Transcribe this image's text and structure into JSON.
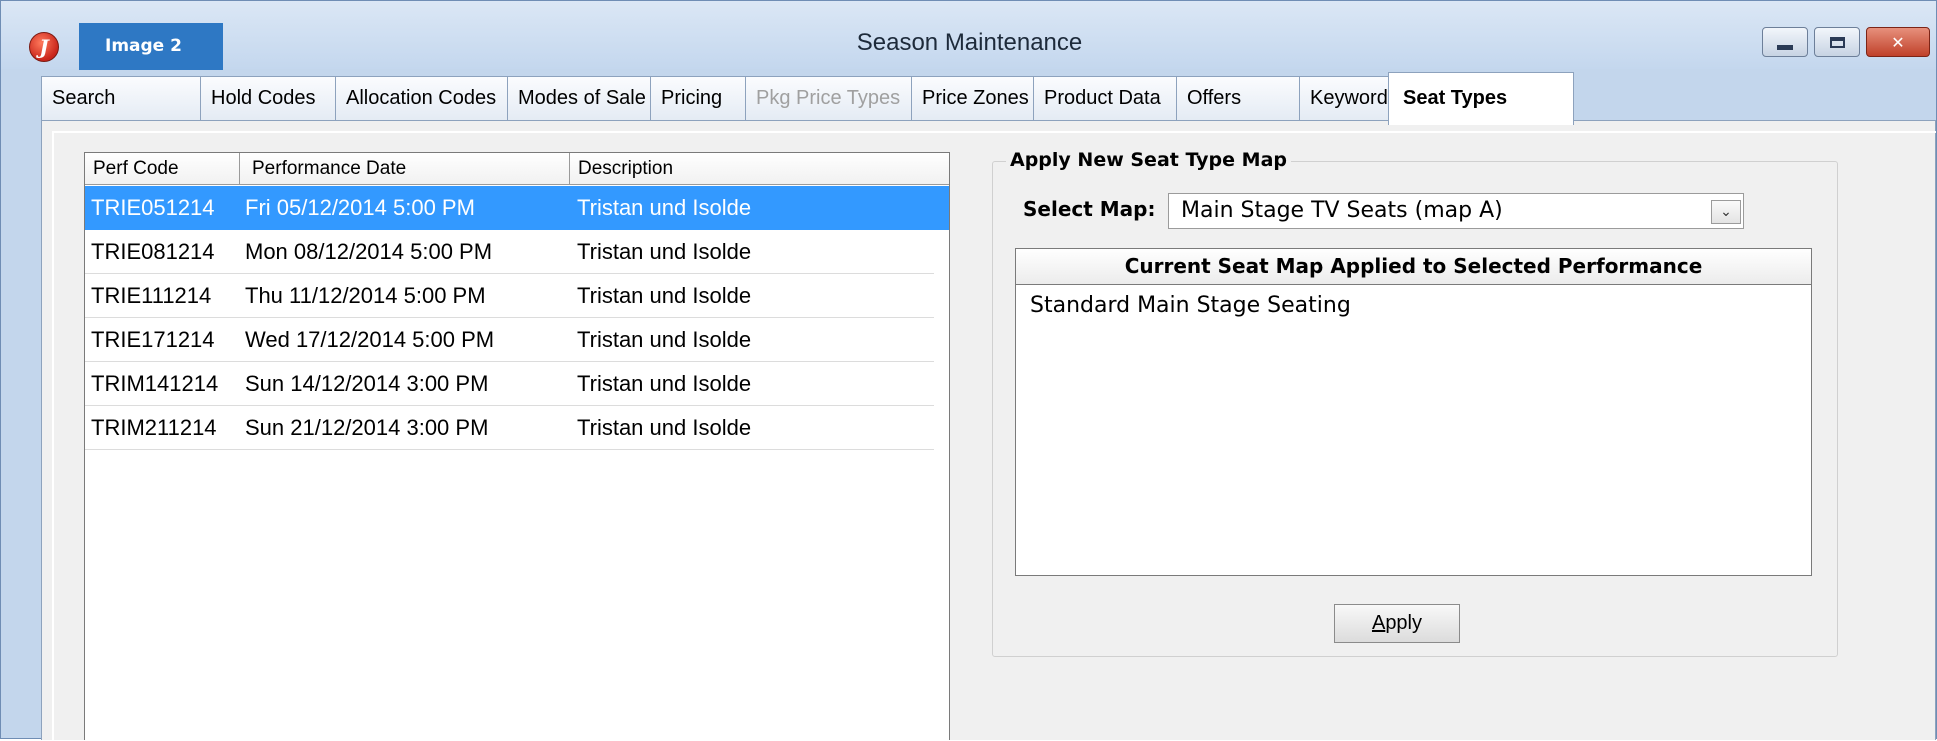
{
  "window": {
    "title": "Season Maintenance",
    "image_tag": "Image 2",
    "app_icon_glyph": "J",
    "accent_color": "#3399ff"
  },
  "tabs": [
    {
      "label": "Search",
      "state": "normal"
    },
    {
      "label": "Hold Codes",
      "state": "normal"
    },
    {
      "label": "Allocation Codes",
      "state": "normal"
    },
    {
      "label": "Modes of Sale",
      "state": "normal"
    },
    {
      "label": "Pricing",
      "state": "normal"
    },
    {
      "label": "Pkg Price Types",
      "state": "disabled"
    },
    {
      "label": "Price Zones",
      "state": "normal"
    },
    {
      "label": "Product Data",
      "state": "normal"
    },
    {
      "label": "Offers",
      "state": "normal"
    },
    {
      "label": "Keywords",
      "state": "normal"
    },
    {
      "label": "Seat Types",
      "state": "active"
    }
  ],
  "performance_list": {
    "columns": [
      "Perf Code",
      "Performance Date",
      "Description"
    ],
    "rows": [
      {
        "code": "TRIE051214",
        "date": "Fri 05/12/2014 5:00 PM",
        "description": "Tristan und Isolde",
        "selected": true
      },
      {
        "code": "TRIE081214",
        "date": "Mon 08/12/2014 5:00 PM",
        "description": "Tristan und Isolde",
        "selected": false
      },
      {
        "code": "TRIE111214",
        "date": "Thu 11/12/2014 5:00 PM",
        "description": "Tristan und Isolde",
        "selected": false
      },
      {
        "code": "TRIE171214",
        "date": "Wed 17/12/2014 5:00 PM",
        "description": "Tristan und Isolde",
        "selected": false
      },
      {
        "code": "TRIM141214",
        "date": "Sun 14/12/2014 3:00 PM",
        "description": "Tristan und Isolde",
        "selected": false
      },
      {
        "code": "TRIM211214",
        "date": "Sun 21/12/2014 3:00 PM",
        "description": "Tristan und Isolde",
        "selected": false
      }
    ]
  },
  "seat_type_map": {
    "group_title": "Apply New Seat Type Map",
    "select_label": "Select Map:",
    "selected_map": "Main Stage TV Seats (map A)",
    "current_map_header": "Current Seat Map Applied to Selected Performance",
    "current_maps": [
      "Standard Main Stage Seating"
    ],
    "apply_label_mnemonic": "A",
    "apply_label_rest": "pply"
  },
  "icons": {
    "minimize": "minimize-icon",
    "maximize": "maximize-icon",
    "close": "close-icon",
    "dropdown": "chevron-down-icon"
  }
}
